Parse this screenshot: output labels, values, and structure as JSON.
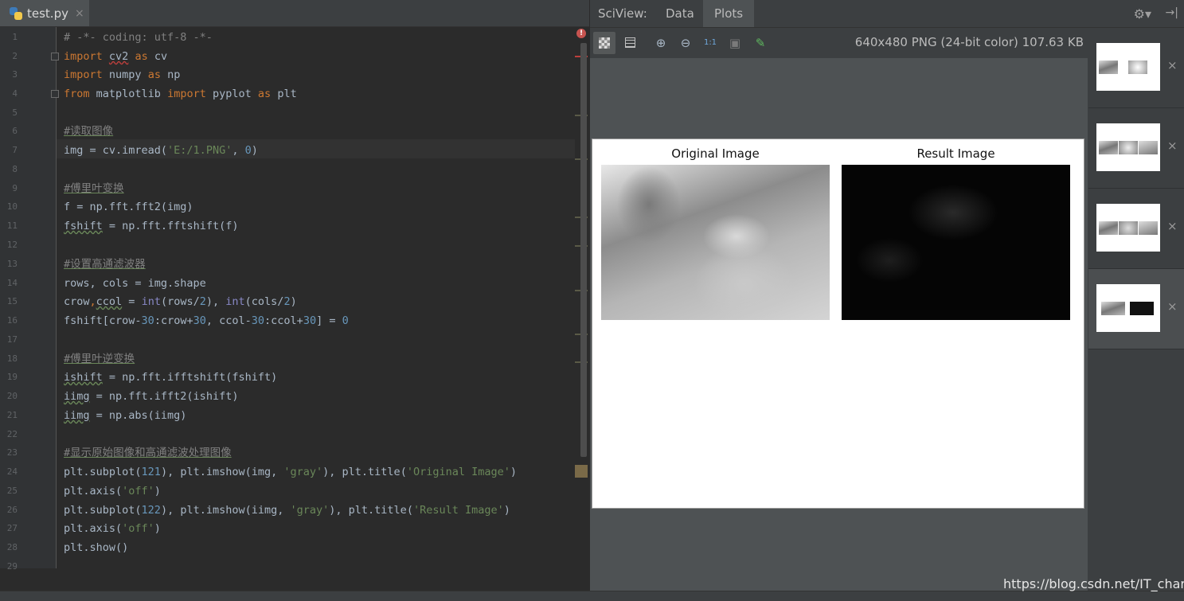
{
  "editor": {
    "tab": {
      "filename": "test.py",
      "close": "×"
    },
    "error_marker": "!",
    "lines": [
      {
        "n": "1"
      },
      {
        "n": "2"
      },
      {
        "n": "3"
      },
      {
        "n": "4"
      },
      {
        "n": "5"
      },
      {
        "n": "6"
      },
      {
        "n": "7"
      },
      {
        "n": "8"
      },
      {
        "n": "9"
      },
      {
        "n": "10"
      },
      {
        "n": "11"
      },
      {
        "n": "12"
      },
      {
        "n": "13"
      },
      {
        "n": "14"
      },
      {
        "n": "15"
      },
      {
        "n": "16"
      },
      {
        "n": "17"
      },
      {
        "n": "18"
      },
      {
        "n": "19"
      },
      {
        "n": "20"
      },
      {
        "n": "21"
      },
      {
        "n": "22"
      },
      {
        "n": "23"
      },
      {
        "n": "24"
      },
      {
        "n": "25"
      },
      {
        "n": "26"
      },
      {
        "n": "27"
      },
      {
        "n": "28"
      },
      {
        "n": "29"
      }
    ],
    "code": {
      "l1": "# -*- coding: utf-8 -*-",
      "l2a": "import",
      "l2b": "cv2",
      "l2c": "as",
      "l2d": "cv",
      "l3a": "import",
      "l3b": "numpy",
      "l3c": "as",
      "l3d": "np",
      "l4a": "from",
      "l4b": "matplotlib",
      "l4c": "import",
      "l4d": "pyplot",
      "l4e": "as",
      "l4f": "plt",
      "l6": "#读取图像",
      "l7a": "img = cv.imread(",
      "l7b": "'E:/1.PNG'",
      "l7c": ", ",
      "l7d": "0",
      "l7e": ")",
      "l9": "#傅里叶变换",
      "l10": "f = np.fft.fft2(img)",
      "l11a": "fshift",
      "l11b": " = np.fft.fftshift(f)",
      "l13": "#设置高通滤波器",
      "l14": "rows, cols = img.shape",
      "l15a": "crow",
      "l15b": ",",
      "l15c": "ccol",
      "l15d": " = ",
      "l15e": "int",
      "l15f": "(rows/",
      "l15g": "2",
      "l15h": "), ",
      "l15i": "int",
      "l15j": "(cols/",
      "l15k": "2",
      "l15l": ")",
      "l16a": "fshift[crow-",
      "l16b": "30",
      "l16c": ":crow+",
      "l16d": "30",
      "l16e": ", ccol-",
      "l16f": "30",
      "l16g": ":ccol+",
      "l16h": "30",
      "l16i": "] = ",
      "l16j": "0",
      "l18": "#傅里叶逆变换",
      "l19a": "ishift",
      "l19b": " = np.fft.ifftshift(fshift)",
      "l20a": "iimg",
      "l20b": " = np.fft.ifft2(ishift)",
      "l21a": "iimg",
      "l21b": " = np.abs(iimg)",
      "l23": "#显示原始图像和高通滤波处理图像",
      "l24a": "plt.subplot(",
      "l24b": "121",
      "l24c": "), plt.imshow(img, ",
      "l24d": "'gray'",
      "l24e": "), plt.title(",
      "l24f": "'Original Image'",
      "l24g": ")",
      "l25a": "plt.axis(",
      "l25b": "'off'",
      "l25c": ")",
      "l26a": "plt.subplot(",
      "l26b": "122",
      "l26c": "), plt.imshow(iimg, ",
      "l26d": "'gray'",
      "l26e": "), plt.title(",
      "l26f": "'Result Image'",
      "l26g": ")",
      "l27a": "plt.axis(",
      "l27b": "'off'",
      "l27c": ")",
      "l28": "plt.show()"
    }
  },
  "sciview": {
    "title": "SciView:",
    "tabs": [
      "Data",
      "Plots"
    ],
    "active_tab": "Plots",
    "toolbar": {
      "zoom_in": "⊕",
      "zoom_out": "⊖",
      "actual_size": "1:1",
      "fit": "▣",
      "picker": "✎"
    },
    "image_info": "640x480 PNG (24-bit color) 107.63 KB",
    "figure": {
      "left_title": "Original Image",
      "right_title": "Result Image"
    },
    "thumbnails": [
      {
        "selected": false
      },
      {
        "selected": false
      },
      {
        "selected": false
      },
      {
        "selected": true
      }
    ],
    "thumb_close": "×",
    "gear": "⚙▾",
    "pin": "→|"
  },
  "watermark": "https://blog.csdn.net/IT_charge"
}
